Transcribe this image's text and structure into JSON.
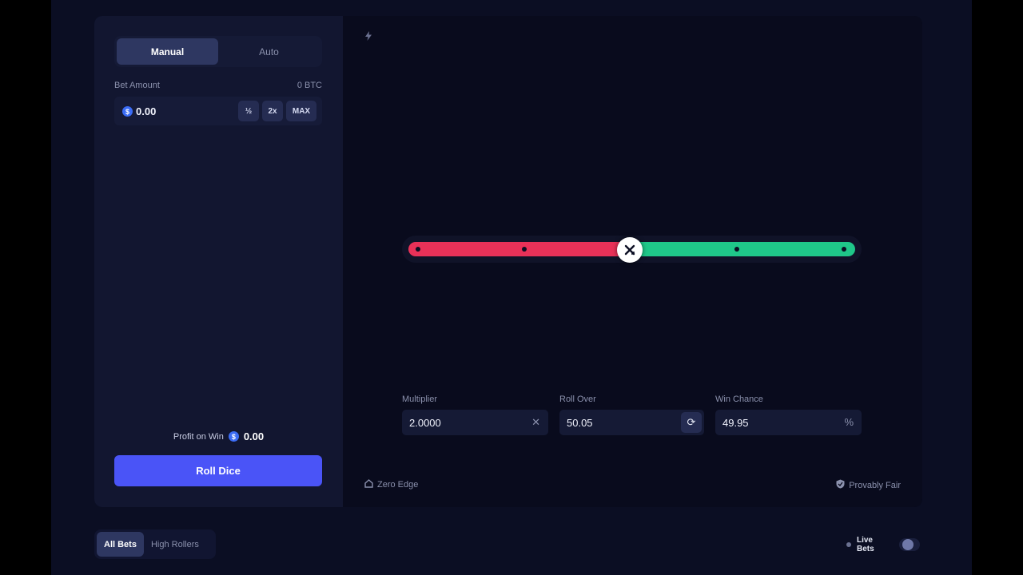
{
  "sidebar": {
    "tabs": [
      {
        "label": "Manual",
        "active": true
      },
      {
        "label": "Auto",
        "active": false
      }
    ],
    "bet": {
      "label": "Bet Amount",
      "balance": "0 BTC",
      "coin_symbol": "$",
      "value": "0.00",
      "half_label": "½",
      "double_label": "2x",
      "max_label": "MAX"
    },
    "profit": {
      "label": "Profit on Win",
      "coin_symbol": "$",
      "value": "0.00"
    },
    "roll_button": "Roll Dice"
  },
  "stage": {
    "slider": {
      "value": 50.05,
      "min": 0,
      "max": 100,
      "lose_color": "#e83158",
      "win_color": "#1fc789"
    },
    "stats": {
      "multiplier": {
        "label": "Multiplier",
        "value": "2.0000",
        "icon": "close-icon"
      },
      "roll_over": {
        "label": "Roll Over",
        "value": "50.05",
        "icon": "refresh-icon"
      },
      "win_chance": {
        "label": "Win Chance",
        "value": "49.95",
        "icon": "percent-icon"
      }
    },
    "footer": {
      "left": "Zero Edge",
      "right": "Provably Fair"
    }
  },
  "bottom": {
    "tabs": [
      {
        "label": "All Bets",
        "active": true
      },
      {
        "label": "High Rollers",
        "active": false
      }
    ],
    "live_label": "Live Bets"
  },
  "colors": {
    "accent": "#4a54f7",
    "page_bg": "#0b0e23",
    "panel_bg": "#121630"
  }
}
